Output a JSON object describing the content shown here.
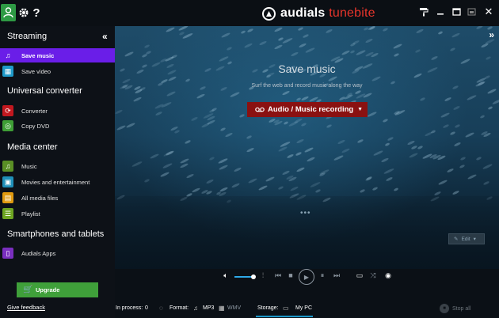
{
  "app": {
    "brand_main": "audials",
    "brand_accent": "tunebite"
  },
  "colors": {
    "accent_purple": "#6a1ee8",
    "record_red": "#8a1111",
    "upgrade_green": "#3fa03a",
    "icon_green": "#2e9a44"
  },
  "icons": {
    "user": "user-icon",
    "settings": "gear-icon",
    "help": "help-icon",
    "logo": "audials-logo-icon"
  },
  "sidebar": {
    "sections": [
      {
        "title": "Streaming",
        "items": [
          {
            "label": "Save music",
            "icon": "music-note-icon",
            "color": "#6a1ee8",
            "active": true
          },
          {
            "label": "Save video",
            "icon": "film-icon",
            "color": "#1f9ac9",
            "active": false
          }
        ]
      },
      {
        "title": "Universal converter",
        "items": [
          {
            "label": "Converter",
            "icon": "convert-icon",
            "color": "#c2181f",
            "active": false
          },
          {
            "label": "Copy DVD",
            "icon": "dvd-copy-icon",
            "color": "#3f9f36",
            "active": false
          }
        ]
      },
      {
        "title": "Media center",
        "items": [
          {
            "label": "Music",
            "icon": "music-icon",
            "color": "#5a8f25",
            "active": false
          },
          {
            "label": "Movies and entertainment",
            "icon": "movies-icon",
            "color": "#1f8fb8",
            "active": false
          },
          {
            "label": "All media files",
            "icon": "files-icon",
            "color": "#e09a10",
            "active": false
          },
          {
            "label": "Playlist",
            "icon": "playlist-icon",
            "color": "#6ea522",
            "active": false
          }
        ]
      },
      {
        "title": "Smartphones and tablets",
        "items": [
          {
            "label": "Audials Apps",
            "icon": "tablet-icon",
            "color": "#7a2fbf",
            "active": false
          }
        ]
      }
    ],
    "upgrade_label": "Upgrade",
    "feedback_label": "Give feedback"
  },
  "main": {
    "heading": "Save music",
    "subheading": "Surf the web and record music along the way",
    "record_button": "Audio / Music recording",
    "dots": "•••",
    "edit_label": "Edit"
  },
  "status": {
    "in_process_label": "In process:",
    "in_process_count": "0",
    "format_label": "Format:",
    "format_mp3": "MP3",
    "format_wmv": "WMV",
    "storage_label": "Storage:",
    "storage_value": "My PC",
    "stop_all": "Stop all"
  }
}
